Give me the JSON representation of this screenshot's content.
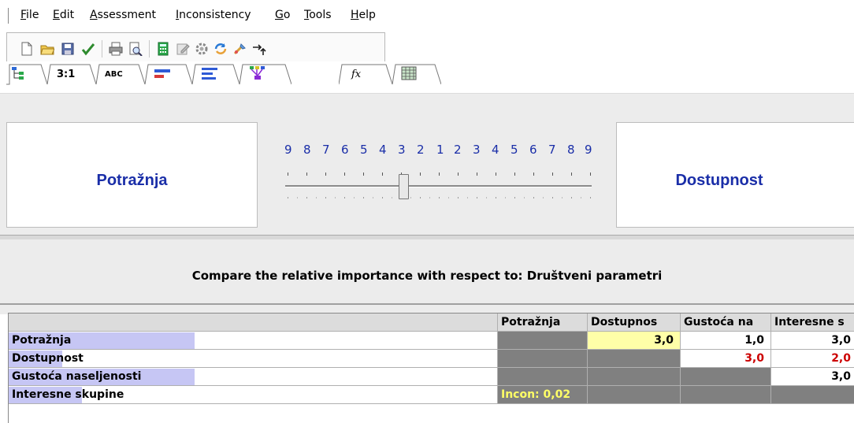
{
  "menu": {
    "items": [
      {
        "prefix": "",
        "ul": "F",
        "rest": "ile"
      },
      {
        "prefix": "",
        "ul": "E",
        "rest": "dit"
      },
      {
        "prefix": "",
        "ul": "A",
        "rest": "ssessment"
      },
      {
        "prefix": "",
        "ul": "I",
        "rest": "nconsistency"
      },
      {
        "prefix": "",
        "ul": "G",
        "rest": "o"
      },
      {
        "prefix": "",
        "ul": "T",
        "rest": "ools"
      },
      {
        "prefix": "",
        "ul": "H",
        "rest": "elp"
      }
    ]
  },
  "toolbar": {
    "icons": [
      "new-file-icon",
      "open-folder-icon",
      "save-icon",
      "check-icon",
      "print-icon",
      "print-preview-icon",
      "calculator-icon",
      "edit-icon",
      "settings-icon",
      "refresh-icon",
      "tools-icon",
      "arrow-icon"
    ]
  },
  "tabs": [
    {
      "icon": "tree-icon",
      "label": ""
    },
    {
      "icon": "",
      "label": "3:1"
    },
    {
      "icon": "",
      "label": "ABC"
    },
    {
      "icon": "bars-icon",
      "label": ""
    },
    {
      "icon": "lines-icon",
      "label": ""
    },
    {
      "icon": "merge-icon",
      "label": ""
    },
    {
      "icon": "",
      "label": "fx"
    },
    {
      "icon": "grid-icon",
      "label": ""
    }
  ],
  "comparison": {
    "left_element": "Potražnja",
    "right_element": "Dostupnost",
    "scale": [
      "9",
      "8",
      "7",
      "6",
      "5",
      "4",
      "3",
      "2",
      "1",
      "2",
      "3",
      "4",
      "5",
      "6",
      "7",
      "8",
      "9"
    ],
    "slider_value": "3",
    "slider_side": "left",
    "prompt": "Compare the relative importance with respect to: Društveni parametri"
  },
  "grid": {
    "columns": [
      "Potražnja",
      "Dostupnos",
      "Gustoća na",
      "Interesne s"
    ],
    "rows": [
      {
        "label": "Potražnja",
        "bar": 0.38,
        "cells": [
          "",
          "3,0",
          "1,0",
          "3,0"
        ]
      },
      {
        "label": "Dostupnost",
        "bar": 0.11,
        "cells": [
          "",
          "",
          "3,0",
          "2,0"
        ]
      },
      {
        "label": "Gustoća naseljenosti",
        "bar": 0.38,
        "cells": [
          "",
          "",
          "",
          "3,0"
        ]
      },
      {
        "label": "Interesne skupine",
        "bar": 0.15,
        "cells": [
          "Incon: 0,02",
          "",
          "",
          ""
        ]
      }
    ]
  },
  "colors": {
    "accent_text": "#1a2ea8",
    "selected_cell": "#ffffa8",
    "inverted_value": "#cc0000",
    "priority_bar": "#c6c6f4"
  }
}
